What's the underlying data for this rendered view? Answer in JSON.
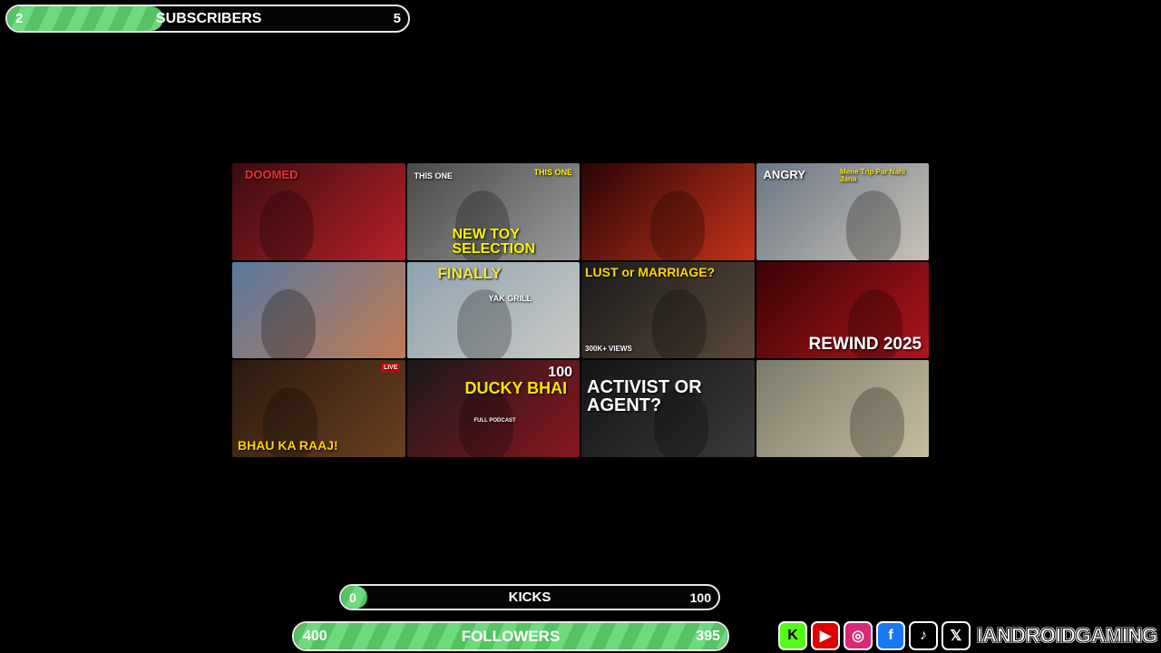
{
  "subscribers_bar": {
    "label": "SUBSCRIBERS",
    "current": "2",
    "goal": "5",
    "progress": 0.39
  },
  "kicks_bar": {
    "label": "KICKS",
    "current": "0",
    "goal": "100",
    "progress": 0.07
  },
  "followers_bar": {
    "label": "FOLLOWERS",
    "current": "400",
    "goal": "395",
    "progress": 1.0
  },
  "thumbnails": [
    {
      "caption": "DOOMED",
      "colors": [
        "#3a0d10",
        "#b8202a"
      ]
    },
    {
      "caption": "NEW TOY SELECTION",
      "sub": "THIS ONE",
      "sub2": "THIS ONE",
      "colors": [
        "#4a4a4a",
        "#9a9a9a"
      ]
    },
    {
      "caption": "",
      "colors": [
        "#2a0505",
        "#c4321a"
      ]
    },
    {
      "caption": "ANGRY",
      "sub": "Mene Trip Par Nahi Jana",
      "colors": [
        "#6b7686",
        "#c8c2b6"
      ]
    },
    {
      "caption": "",
      "colors": [
        "#5a7aa0",
        "#c07a52"
      ]
    },
    {
      "caption": "FINALLY",
      "sub": "YAK GRILL",
      "colors": [
        "#8fa2b0",
        "#c8c9c4"
      ]
    },
    {
      "caption": "LUST or MARRIAGE?",
      "sub": "300K+ VIEWS",
      "colors": [
        "#1a1a1a",
        "#5b4a3a"
      ]
    },
    {
      "caption": "REWIND 2025",
      "colors": [
        "#3a0406",
        "#b0141d"
      ]
    },
    {
      "caption": "BHAU KA RAAJ!",
      "sub": "LIVE",
      "colors": [
        "#2a1a10",
        "#6a4020"
      ]
    },
    {
      "caption": "DUCKY BHAI",
      "sub": "FULL PODCAST",
      "sub2": "100",
      "colors": [
        "#1a1a1a",
        "#8a1620"
      ]
    },
    {
      "caption": "ACTIVIST OR AGENT?",
      "colors": [
        "#141414",
        "#3a3a3a"
      ]
    },
    {
      "caption": "",
      "colors": [
        "#7a7a6a",
        "#c8bca0"
      ]
    }
  ],
  "socials": [
    {
      "icon": "kick-icon",
      "glyph": "K",
      "bg": "#53fc18",
      "fg": "#000"
    },
    {
      "icon": "youtube-icon",
      "glyph": "▶",
      "bg": "#e00000",
      "fg": "#fff"
    },
    {
      "icon": "instagram-icon",
      "glyph": "◎",
      "bg": "#d62976",
      "fg": "#fff"
    },
    {
      "icon": "facebook-icon",
      "glyph": "f",
      "bg": "#1877f2",
      "fg": "#fff"
    },
    {
      "icon": "tiktok-icon",
      "glyph": "♪",
      "bg": "#000",
      "fg": "#fff"
    },
    {
      "icon": "x-icon",
      "glyph": "𝕏",
      "bg": "#000",
      "fg": "#fff"
    }
  ],
  "brand_name": "IANDROIDGAMING"
}
